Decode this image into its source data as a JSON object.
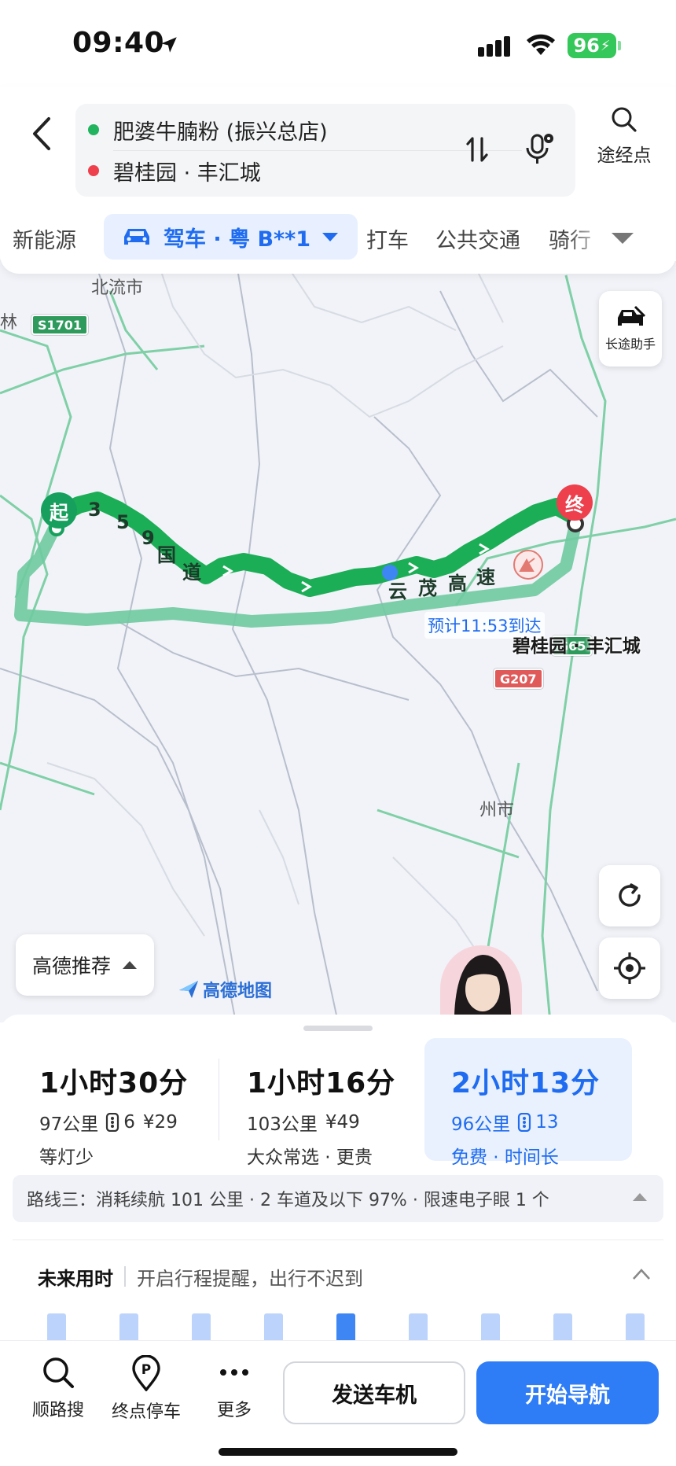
{
  "status_bar": {
    "time": "09:40",
    "battery": "96"
  },
  "route": {
    "origin": "肥婆牛腩粉 (振兴总店)",
    "destination": "碧桂园 · 丰汇城",
    "waypoint_label": "途经点"
  },
  "modes": {
    "new_energy": "新能源",
    "drive": "驾车 · 粤 B**1",
    "taxi": "打车",
    "transit": "公共交通",
    "ride": "骑行"
  },
  "map": {
    "city_label": "北流市",
    "city_label_2": "州市",
    "edge_label": "林",
    "shields": {
      "s1701": "S1701",
      "g65": "G65",
      "g207": "G207"
    },
    "road_359": [
      "3",
      "5",
      "9",
      "国",
      "道"
    ],
    "road_yunmao": [
      "云",
      "茂",
      "高",
      "速"
    ],
    "eta": "预计11:53到达",
    "dest_label": "碧桂园 · 丰汇城",
    "start_pin": "起",
    "end_pin": "终",
    "assist_label": "长途助手",
    "recommend_label": "高德推荐",
    "logo_text": "高德地图",
    "colors": {
      "route_main": "#1cae56",
      "route_alt": "#6fcaa0",
      "accent": "#1f6cf0"
    }
  },
  "routes": [
    {
      "duration": "1小时30分",
      "distance": "97公里",
      "lights": "6",
      "cost": "¥29",
      "note": "等灯少"
    },
    {
      "duration": "1小时16分",
      "distance": "103公里",
      "lights": "",
      "cost": "¥49",
      "note": "大众常选 · 更贵"
    },
    {
      "duration": "2小时13分",
      "distance": "96公里",
      "lights": "13",
      "cost": "",
      "note": "免费 · 时间长"
    }
  ],
  "route_info": "路线三：消耗续航 101 公里 · 2 车道及以下 97% · 限速电子眼 1 个",
  "future": {
    "title": "未来用时",
    "subtitle": "开启行程提醒，出行不迟到",
    "bar_levels": [
      0.8,
      0.8,
      0.8,
      0.8,
      0.8,
      0.8,
      0.8,
      0.8,
      0.8
    ],
    "current_index": 4
  },
  "actions": {
    "search_along": "顺路搜",
    "dest_parking": "终点停车",
    "more": "更多",
    "send_to_car": "发送车机",
    "start_nav": "开始导航"
  }
}
